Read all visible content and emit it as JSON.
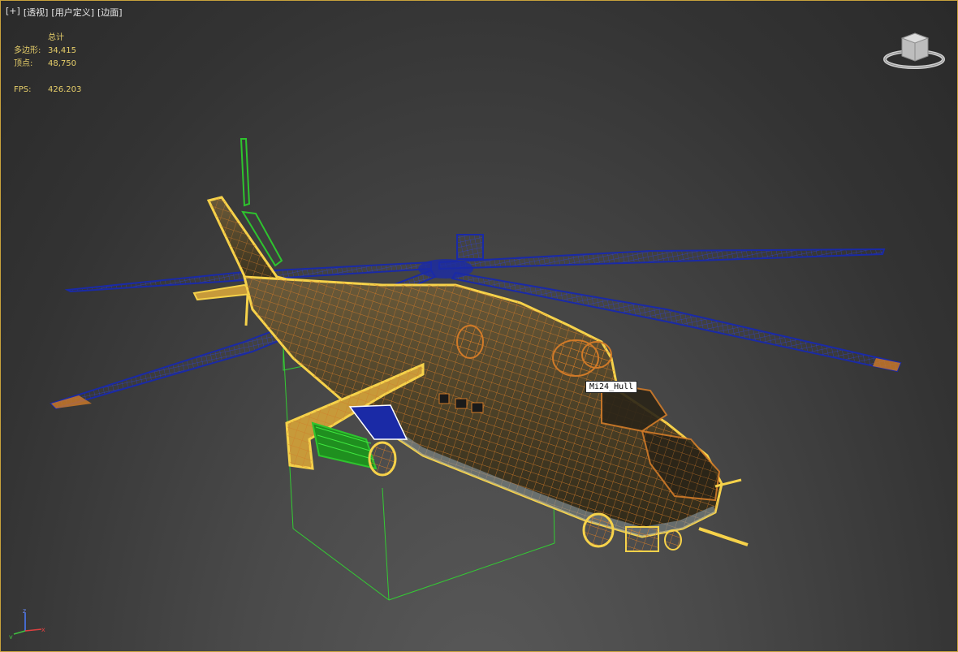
{
  "viewport_menu": [
    {
      "label": "[+]",
      "name": "viewport-plus-menu"
    },
    {
      "label": "[透视]",
      "name": "viewport-perspective-menu"
    },
    {
      "label": "[用户定义]",
      "name": "viewport-user-defined-menu"
    },
    {
      "label": "[边面]",
      "name": "viewport-edged-faces-menu"
    }
  ],
  "stats": {
    "header": "总计",
    "polygons_label": "多边形:",
    "polygons_value": "34,415",
    "vertices_label": "顶点:",
    "vertices_value": "48,750",
    "fps_label": "FPS:",
    "fps_value": "426.203"
  },
  "object_tooltip": "Mi24_Hull",
  "axis_labels": {
    "x": "x",
    "y": "y",
    "z": "z"
  },
  "colors": {
    "selection_outline": "#f6d24a",
    "wireframe": "#d07a28",
    "rotor_wire": "#1a2aa6",
    "green_object": "#2ec42e",
    "stats_text": "#e7cf6a"
  },
  "icons": {
    "viewcube": "viewcube-icon",
    "axis": "axis-tripod-icon"
  }
}
